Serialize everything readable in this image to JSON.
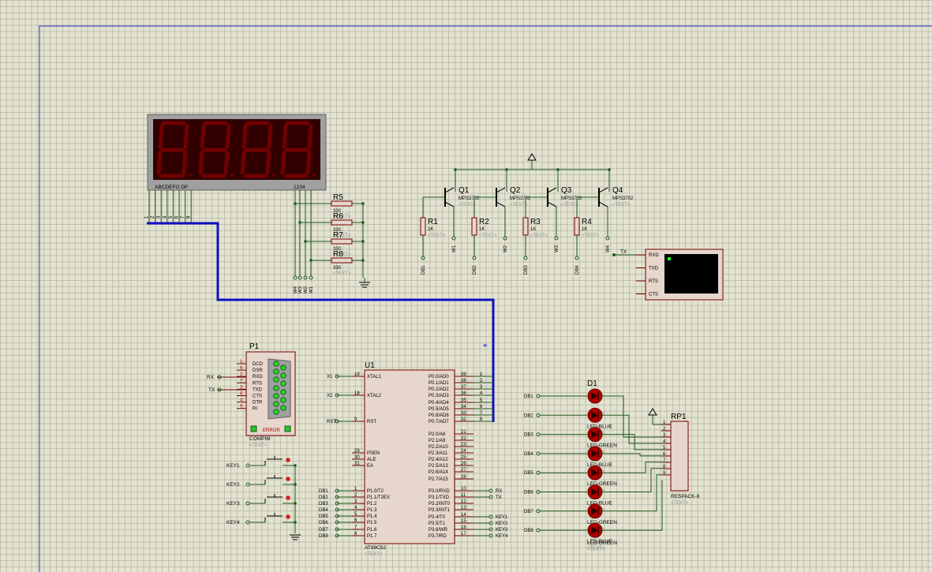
{
  "colors": {
    "background": "#e3e3d0",
    "grid": "#9a9a8c",
    "wire": "#1e5a1e",
    "bus": "#1010c0",
    "sheet_border": "#3030c8",
    "component_body": "#e7d6cc",
    "component_outline": "#700000",
    "led_red": "#b00000",
    "seg_display_bg": "#300000",
    "terminal_screen": "#000000"
  },
  "display": {
    "seg_labels": "ABCDEFG  DP",
    "digit_labels": "1234",
    "pin_labels": [
      "1",
      "2",
      "3",
      "4",
      "5",
      "6",
      "7",
      "8"
    ]
  },
  "resistors_top": {
    "items": [
      {
        "ref": "R5",
        "value": "330",
        "text": "<TEXT>"
      },
      {
        "ref": "R6",
        "value": "330",
        "text": "<TEXT>"
      },
      {
        "ref": "R7",
        "value": "330",
        "text": "<TEXT>"
      },
      {
        "ref": "R8",
        "value": "330",
        "text": "<TEXT>"
      }
    ],
    "net_labels": [
      "W4",
      "W3",
      "W2",
      "W1"
    ]
  },
  "transistors": {
    "power_symbol": "Δ",
    "items": [
      {
        "ref": "Q1",
        "part": "MPS3702",
        "text": "<TEXT>",
        "net": "W1"
      },
      {
        "ref": "Q2",
        "part": "MPS3702",
        "text": "<TEXT>",
        "net": "W2"
      },
      {
        "ref": "Q3",
        "part": "MPS3702",
        "text": "<TEXT>",
        "net": "W3"
      },
      {
        "ref": "Q4",
        "part": "MPS3702",
        "text": "<TEXT>",
        "net": "W4"
      }
    ]
  },
  "base_resistors": {
    "items": [
      {
        "ref": "R1",
        "value": "1K",
        "text": "<TEXT>",
        "net": "DB1"
      },
      {
        "ref": "R2",
        "value": "1K",
        "text": "<TEXT>",
        "net": "DB2"
      },
      {
        "ref": "R3",
        "value": "1K",
        "text": "<TEXT>",
        "net": "DB3"
      },
      {
        "ref": "R4",
        "value": "1K",
        "text": "<TEXT>",
        "net": "DB4"
      }
    ]
  },
  "terminal": {
    "net": "TX",
    "pins": [
      "RXD",
      "TXD",
      "RTS",
      "CTS"
    ]
  },
  "com_port": {
    "ref": "P1",
    "name": "COMPIM",
    "text": "<TEXT>",
    "status": "ERROR",
    "pins": [
      {
        "num": "1",
        "name": "DCD"
      },
      {
        "num": "6",
        "name": "DSR"
      },
      {
        "num": "2",
        "name": "RXD"
      },
      {
        "num": "7",
        "name": "RTS"
      },
      {
        "num": "3",
        "name": "TXD"
      },
      {
        "num": "8",
        "name": "CTS"
      },
      {
        "num": "4",
        "name": "DTR"
      },
      {
        "num": "9",
        "name": "RI"
      }
    ],
    "net_rx": "RX",
    "net_tx": "TX"
  },
  "keys": [
    "KEY1",
    "KEY2",
    "KEY3",
    "KEY4"
  ],
  "mcu": {
    "ref": "U1",
    "part": "AT89C52",
    "text": "<TEXT>",
    "left_pins": [
      {
        "num": "19",
        "name": "XTAL1",
        "net": "X1"
      },
      {
        "num": "18",
        "name": "XTAL2",
        "net": "X2"
      },
      {
        "num": "9",
        "name": "RST",
        "net": "RST"
      },
      {
        "num": "29",
        "name": "PSEN",
        "net": ""
      },
      {
        "num": "30",
        "name": "ALE",
        "net": ""
      },
      {
        "num": "31",
        "name": "EA",
        "net": ""
      },
      {
        "num": "1",
        "name": "P1.0/T2",
        "net": "DB1"
      },
      {
        "num": "2",
        "name": "P1.1/T2EX",
        "net": "DB2"
      },
      {
        "num": "3",
        "name": "P1.2",
        "net": "DB3"
      },
      {
        "num": "4",
        "name": "P1.3",
        "net": "DB4"
      },
      {
        "num": "5",
        "name": "P1.4",
        "net": "DB5"
      },
      {
        "num": "6",
        "name": "P1.5",
        "net": "DB6"
      },
      {
        "num": "7",
        "name": "P1.6",
        "net": "DB7"
      },
      {
        "num": "8",
        "name": "P1.7",
        "net": "DB8"
      }
    ],
    "right_pins": [
      {
        "num": "39",
        "name": "P0.0/AD0",
        "net": "1"
      },
      {
        "num": "38",
        "name": "P0.1/AD1",
        "net": "2"
      },
      {
        "num": "37",
        "name": "P0.2/AD2",
        "net": "3"
      },
      {
        "num": "36",
        "name": "P0.3/AD3",
        "net": "4"
      },
      {
        "num": "35",
        "name": "P0.4/AD4",
        "net": "5"
      },
      {
        "num": "34",
        "name": "P0.5/AD5",
        "net": "6"
      },
      {
        "num": "33",
        "name": "P0.6/AD6",
        "net": "7"
      },
      {
        "num": "32",
        "name": "P0.7/AD7",
        "net": "8"
      },
      {
        "num": "21",
        "name": "P2.0/A8",
        "net": ""
      },
      {
        "num": "22",
        "name": "P2.1/A9",
        "net": ""
      },
      {
        "num": "23",
        "name": "P2.2/A10",
        "net": ""
      },
      {
        "num": "24",
        "name": "P2.3/A11",
        "net": ""
      },
      {
        "num": "25",
        "name": "P2.4/A12",
        "net": ""
      },
      {
        "num": "26",
        "name": "P2.5/A13",
        "net": ""
      },
      {
        "num": "27",
        "name": "P2.6/A14",
        "net": ""
      },
      {
        "num": "28",
        "name": "P2.7/A15",
        "net": ""
      },
      {
        "num": "10",
        "name": "P3.0/RXD",
        "net": "RX"
      },
      {
        "num": "11",
        "name": "P3.1/TXD",
        "net": "TX"
      },
      {
        "num": "12",
        "name": "P3.2/INT0",
        "net": ""
      },
      {
        "num": "13",
        "name": "P3.3/INT1",
        "net": ""
      },
      {
        "num": "14",
        "name": "P3.4/T0",
        "net": "KEY1"
      },
      {
        "num": "15",
        "name": "P3.5/T1",
        "net": "KEY2"
      },
      {
        "num": "16",
        "name": "P3.6/WR",
        "net": "KEY3"
      },
      {
        "num": "17",
        "name": "P3.7/RD",
        "net": "KEY4"
      }
    ]
  },
  "leds": {
    "ref": "D1",
    "items": [
      {
        "net": "DB1",
        "label": ""
      },
      {
        "net": "DB2",
        "label": "LED-BLUE"
      },
      {
        "net": "DB3",
        "label": "LED-GREEN"
      },
      {
        "net": "DB4",
        "label": "LED-BLUE"
      },
      {
        "net": "DB5",
        "label": "LED-GREEN"
      },
      {
        "net": "DB6",
        "label": "LED-BLUE"
      },
      {
        "net": "DB7",
        "label": "LED-GREEN"
      },
      {
        "net": "DB8",
        "label": "LED-BLUE"
      }
    ],
    "last_label": "LED-GREEN",
    "text_label": "<TEXT>"
  },
  "respack": {
    "ref": "RP1",
    "part": "RESPACK-8",
    "text": "<TEXT>",
    "pins": [
      "1",
      "2",
      "3",
      "4",
      "5",
      "6",
      "7",
      "8",
      "9"
    ]
  }
}
